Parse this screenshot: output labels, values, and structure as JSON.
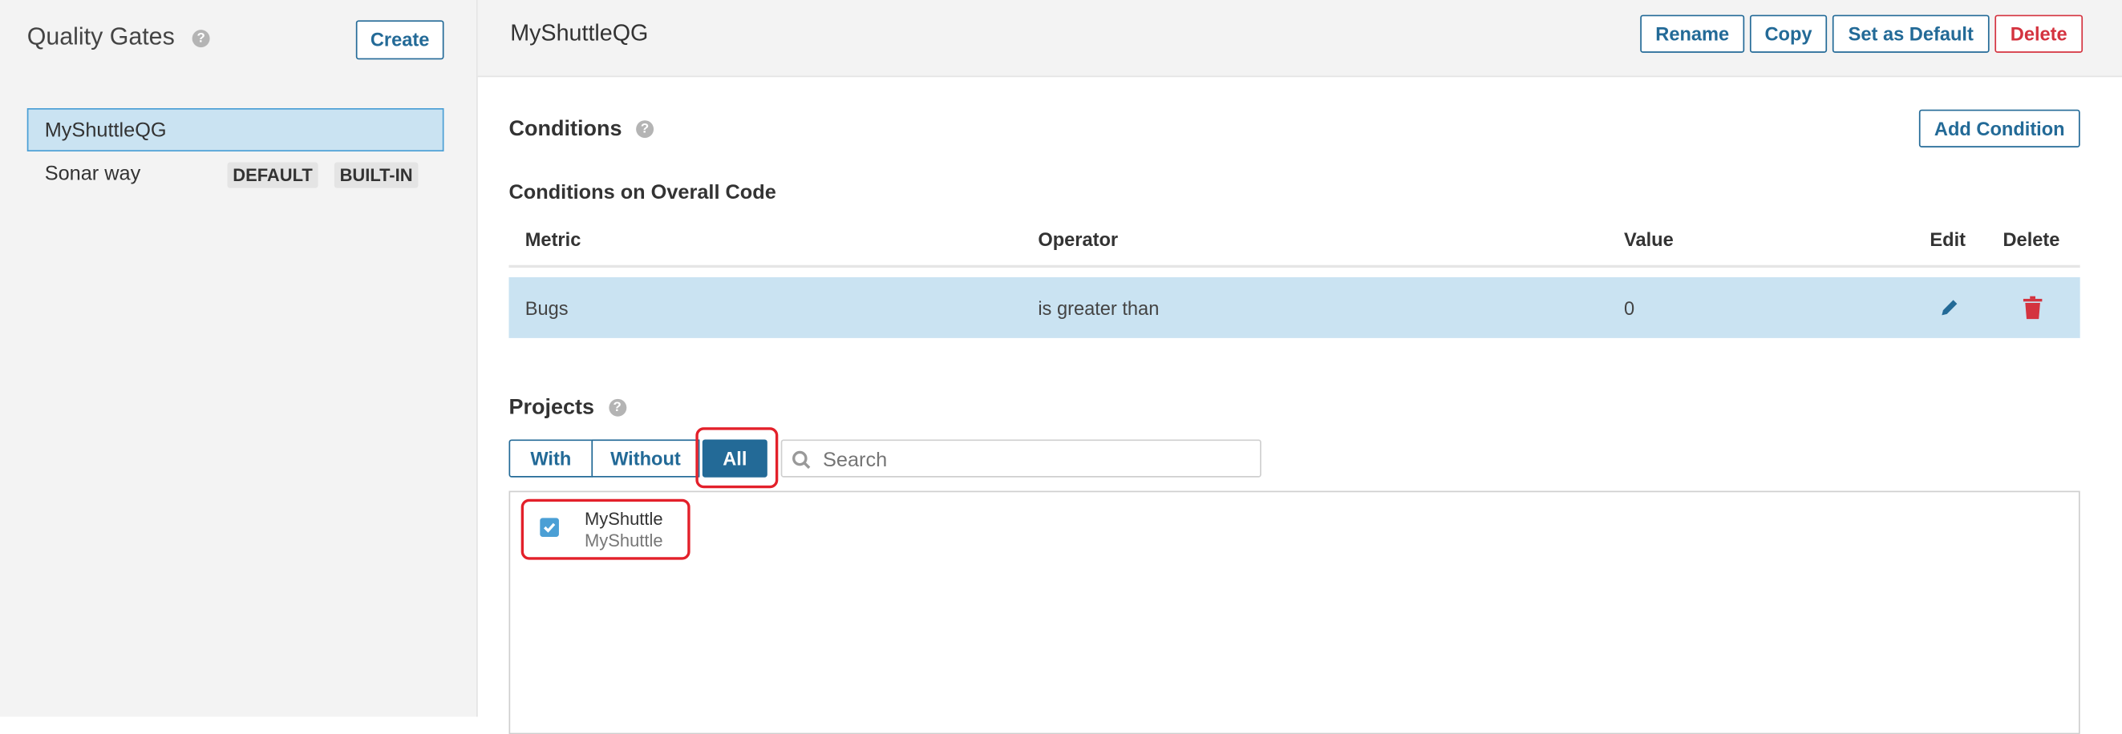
{
  "sidebar": {
    "title": "Quality Gates",
    "help_icon": "?",
    "create_label": "Create",
    "gates": [
      {
        "name": "MyShuttleQG",
        "selected": true,
        "badges": []
      },
      {
        "name": "Sonar way",
        "selected": false,
        "badges": [
          "DEFAULT",
          "BUILT-IN"
        ]
      }
    ]
  },
  "header": {
    "title": "MyShuttleQG",
    "rename_label": "Rename",
    "copy_label": "Copy",
    "set_default_label": "Set as Default",
    "delete_label": "Delete"
  },
  "conditions": {
    "title": "Conditions",
    "add_label": "Add Condition",
    "subtitle": "Conditions on Overall Code",
    "columns": [
      "Metric",
      "Operator",
      "Value",
      "Edit",
      "Delete"
    ],
    "rows": [
      {
        "metric": "Bugs",
        "operator": "is greater than",
        "value": "0"
      }
    ]
  },
  "projects": {
    "title": "Projects",
    "filters": [
      "With",
      "Without",
      "All"
    ],
    "active_filter": "All",
    "search_placeholder": "Search",
    "items": [
      {
        "name": "MyShuttle",
        "key": "MyShuttle",
        "checked": true
      }
    ]
  },
  "colors": {
    "accent": "#236a97",
    "danger": "#d4333f",
    "selected_bg": "#cae3f2",
    "highlight": "#e3202a"
  }
}
